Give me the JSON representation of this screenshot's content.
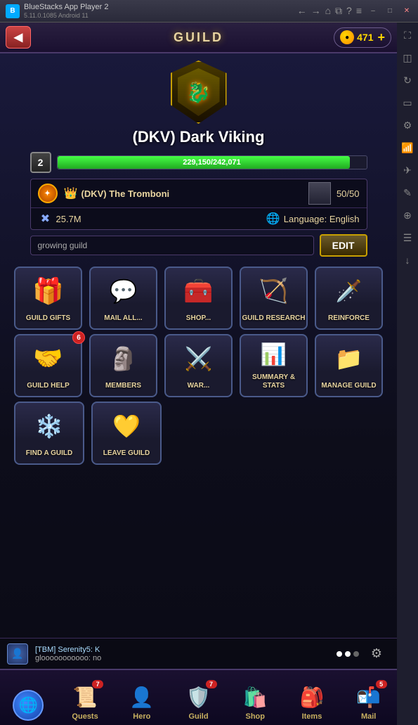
{
  "titlebar": {
    "app_name": "BlueStacks App Player 2",
    "version": "5.11.0.1085  Android 11"
  },
  "topbar": {
    "back_label": "◀",
    "title": "GUILD",
    "currency_amount": "471",
    "plus_label": "+"
  },
  "guild": {
    "name": "(DKV) Dark Viking",
    "level": "2",
    "xp_current": "229,150",
    "xp_max": "242,071",
    "xp_label": "229,150/242,071",
    "xp_percent": 94.6,
    "leader_name": "(DKV) The Tromboni",
    "members": "50/50",
    "power": "25.7M",
    "language": "Language: English",
    "description": "growing guild",
    "edit_label": "EDIT"
  },
  "actions": {
    "row1": [
      {
        "id": "guild-gifts",
        "label": "GUILD GIFTS",
        "icon": "🎁",
        "badge": null
      },
      {
        "id": "mail-all",
        "label": "MAIL ALL...",
        "icon": "✉️",
        "badge": null
      },
      {
        "id": "shop",
        "label": "SHOP...",
        "icon": "🧰",
        "badge": null
      },
      {
        "id": "guild-research",
        "label": "GUILD RESEARCH",
        "icon": "🎯",
        "badge": null
      },
      {
        "id": "reinforce",
        "label": "REINFORCE",
        "icon": "⚔️",
        "badge": null
      }
    ],
    "row2": [
      {
        "id": "guild-help",
        "label": "GUILD HELP",
        "icon": "🤝",
        "badge": "6"
      },
      {
        "id": "members",
        "label": "MEMBERS",
        "icon": "🗿",
        "badge": null
      },
      {
        "id": "war",
        "label": "WAR...",
        "icon": "💥",
        "badge": null
      },
      {
        "id": "summary-stats",
        "label": "SUMMARY &\nSTATS",
        "icon": "📊",
        "badge": null
      },
      {
        "id": "manage-guild",
        "label": "MANAGE GUILD",
        "icon": "📁",
        "badge": null
      }
    ],
    "row3": [
      {
        "id": "find-guild",
        "label": "FIND A GUILD",
        "icon": "❄️",
        "badge": null
      },
      {
        "id": "leave-guild",
        "label": "LEAVE GUILD",
        "icon": "💛",
        "badge": null
      }
    ]
  },
  "notification": {
    "name": "[TBM] Serenity5: K",
    "message": "glooooooooooo: no"
  },
  "bottomnav": {
    "items": [
      {
        "id": "world",
        "label": "",
        "icon": "🌐",
        "badge": null,
        "is_world": true
      },
      {
        "id": "quests",
        "label": "Quests",
        "icon": "📜",
        "badge": "7"
      },
      {
        "id": "hero",
        "label": "Hero",
        "icon": "👤",
        "badge": null
      },
      {
        "id": "guild",
        "label": "Guild",
        "icon": "🛡️",
        "badge": "7"
      },
      {
        "id": "shop",
        "label": "Shop",
        "icon": "🛍️",
        "badge": null
      },
      {
        "id": "items",
        "label": "Items",
        "icon": "🎒",
        "badge": null
      },
      {
        "id": "mail",
        "label": "Mail",
        "icon": "📬",
        "badge": "5"
      }
    ]
  },
  "sidebar": {
    "icons": [
      "⛶",
      "📷",
      "🔄",
      "📺",
      "⚙️",
      "📡",
      "✈️",
      "✏️",
      "📍",
      "☰",
      "⬇"
    ]
  }
}
